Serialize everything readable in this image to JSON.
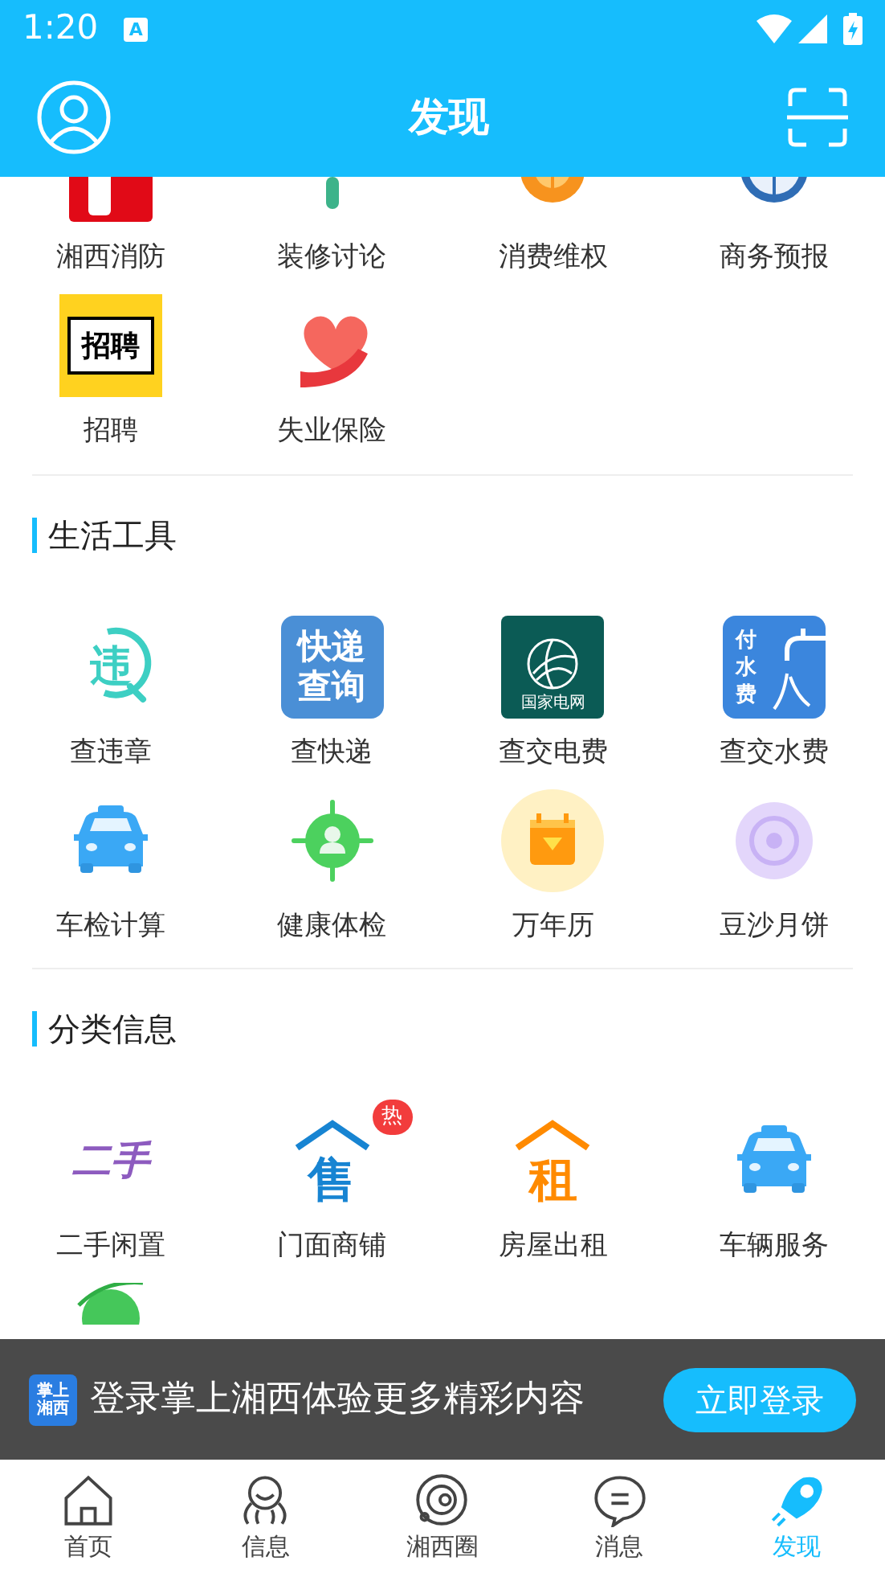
{
  "status_bar": {
    "time": "1:20",
    "notification": "A"
  },
  "header": {
    "title": "发现"
  },
  "sections": [
    {
      "items": [
        {
          "label": "湘西消防"
        },
        {
          "label": "装修讨论"
        },
        {
          "label": "消费维权"
        },
        {
          "label": "商务预报"
        },
        {
          "label": "招聘",
          "icon_text": [
            "招聘"
          ]
        },
        {
          "label": "失业保险"
        }
      ]
    },
    {
      "title": "生活工具",
      "items": [
        {
          "label": "查违章",
          "icon_text": [
            "违"
          ]
        },
        {
          "label": "查快递",
          "icon_text": [
            "快递",
            "查询"
          ]
        },
        {
          "label": "查交电费",
          "icon_text": [
            "国家电网"
          ]
        },
        {
          "label": "查交水费",
          "icon_text": [
            "付",
            "水",
            "费"
          ]
        },
        {
          "label": "车检计算"
        },
        {
          "label": "健康体检"
        },
        {
          "label": "万年历"
        },
        {
          "label": "豆沙月饼"
        }
      ]
    },
    {
      "title": "分类信息",
      "items": [
        {
          "label": "二手闲置",
          "icon_text": [
            "二手"
          ]
        },
        {
          "label": "门面商铺",
          "icon_text": [
            "售"
          ],
          "badge": "热"
        },
        {
          "label": "房屋出租",
          "icon_text": [
            "租"
          ]
        },
        {
          "label": "车辆服务"
        }
      ]
    }
  ],
  "login_banner": {
    "logo_text": [
      "掌上",
      "湘西"
    ],
    "message": "登录掌上湘西体验更多精彩内容",
    "button": "立即登录"
  },
  "tab_bar": [
    {
      "label": "首页",
      "selected": false
    },
    {
      "label": "信息",
      "selected": false
    },
    {
      "label": "湘西圈",
      "selected": false
    },
    {
      "label": "消息",
      "selected": false
    },
    {
      "label": "发现",
      "selected": true
    }
  ]
}
